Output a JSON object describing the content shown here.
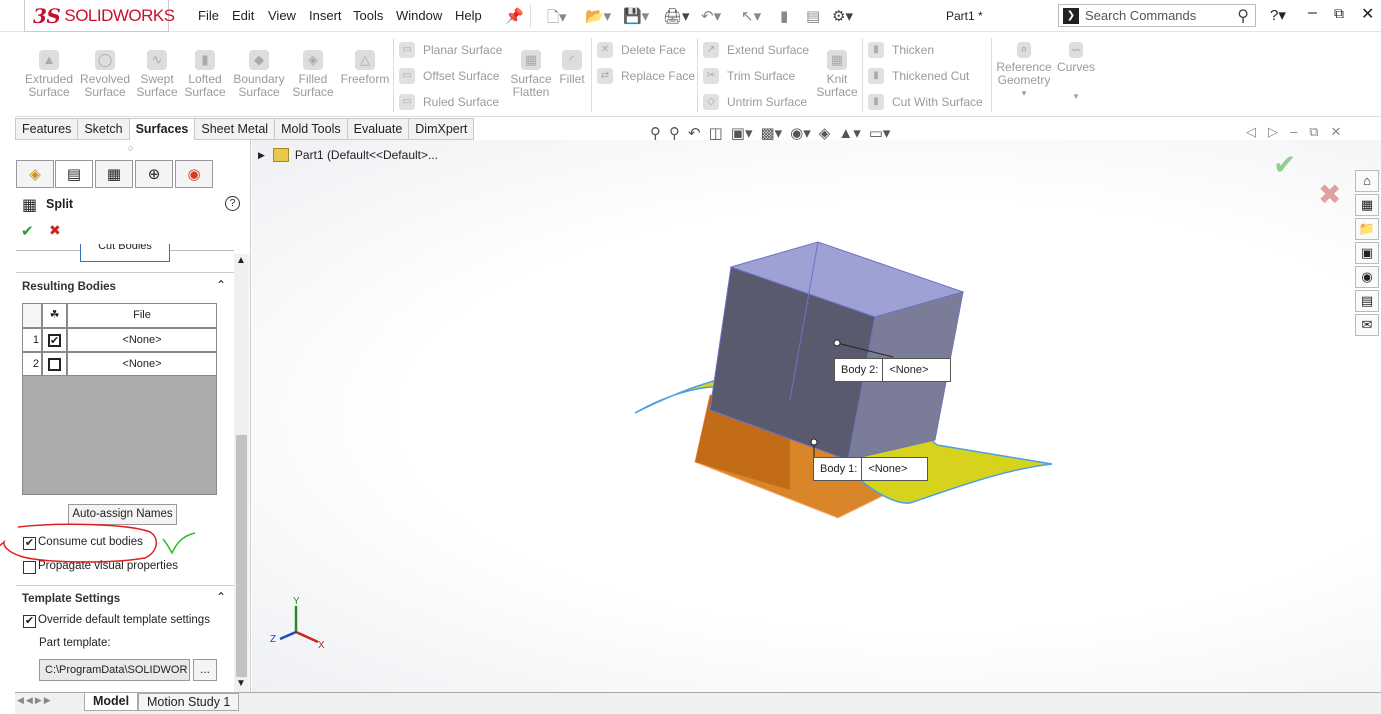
{
  "app": {
    "logo_ds": "3S",
    "logo_brand": "SOLIDWORKS",
    "doc_title": "Part1 *"
  },
  "menu": [
    "File",
    "Edit",
    "View",
    "Insert",
    "Tools",
    "Window",
    "Help"
  ],
  "search": {
    "placeholder": "Search Commands"
  },
  "ribbon": {
    "big": [
      "Extruded Surface",
      "Revolved Surface",
      "Swept Surface",
      "Lofted Surface",
      "Boundary Surface",
      "Filled Surface",
      "Freeform"
    ],
    "planar": "Planar Surface",
    "offset": "Offset Surface",
    "ruled": "Ruled Surface",
    "flatten": "Surface Flatten",
    "fillet": "Fillet",
    "delete_face": "Delete Face",
    "replace_face": "Replace Face",
    "extend": "Extend Surface",
    "trim": "Trim Surface",
    "untrim": "Untrim Surface",
    "knit": "Knit Surface",
    "thicken": "Thicken",
    "thickened_cut": "Thickened Cut",
    "cut_with_surface": "Cut With Surface",
    "ref_geom": "Reference Geometry",
    "curves": "Curves"
  },
  "tabs": [
    "Features",
    "Sketch",
    "Surfaces",
    "Sheet Metal",
    "Mold Tools",
    "Evaluate",
    "DimXpert"
  ],
  "active_tab": "Surfaces",
  "tree": {
    "root": "Part1  (Default<<Default>..."
  },
  "property_manager": {
    "title": "Split",
    "cut_bodies_btn": "Cut Bodies",
    "resulting_bodies": "Resulting Bodies",
    "col_file": "File",
    "rows": [
      {
        "num": "1",
        "checked": true,
        "file": "<None>"
      },
      {
        "num": "2",
        "checked": false,
        "file": "<None>"
      }
    ],
    "auto_assign": "Auto-assign Names",
    "consume": "Consume cut bodies",
    "consume_checked": true,
    "propagate": "Propagate visual properties",
    "propagate_checked": false,
    "template_settings": "Template Settings",
    "override": "Override default template settings",
    "override_checked": true,
    "part_template": "Part template:",
    "template_path": "C:\\ProgramData\\SOLIDWOR",
    "browse": "..."
  },
  "callouts": {
    "body2_label": "Body  2:",
    "body2_value": "<None>",
    "body1_label": "Body  1:",
    "body1_value": "<None>"
  },
  "triad": {
    "x": "X",
    "y": "Y",
    "z": "Z"
  },
  "bottom_tabs": [
    "Model",
    "Motion Study 1"
  ],
  "colors": {
    "accent": "#c8102e",
    "body_orange": "#d9852a",
    "surface_yellow": "#d7d21c",
    "box_blue": "#8c8fc8",
    "annotation_red": "#e0201c",
    "annotation_green": "#22c022"
  }
}
